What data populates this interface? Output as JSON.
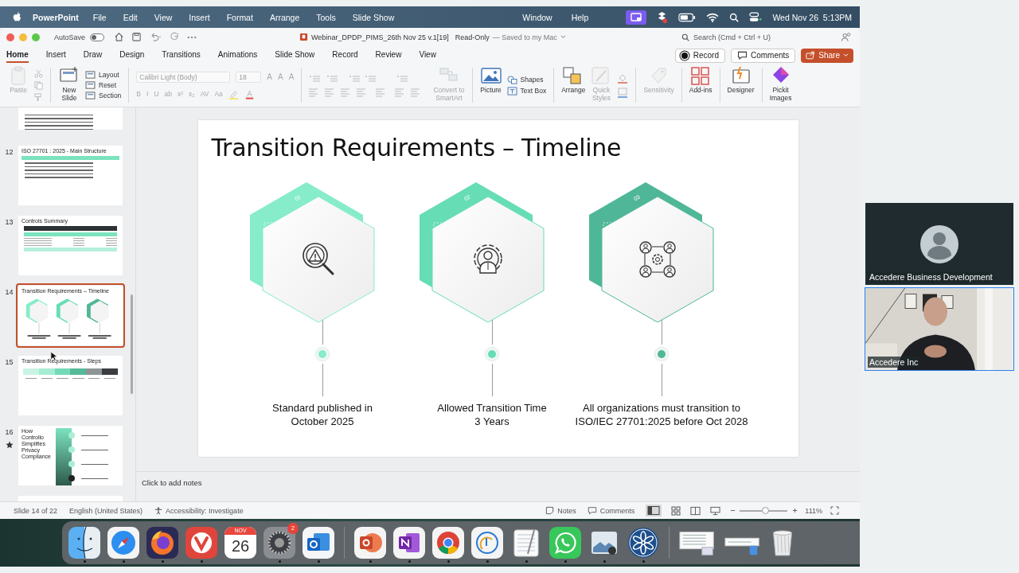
{
  "menu_bar": {
    "app": "PowerPoint",
    "items": [
      "File",
      "Edit",
      "View",
      "Insert",
      "Format",
      "Arrange",
      "Tools",
      "Slide Show"
    ],
    "extra_items": [
      "Window",
      "Help"
    ],
    "clock": "Wed Nov 26  5:13PM"
  },
  "title_bar": {
    "autosave": "AutoSave",
    "autosave_on": false,
    "file": "Webinar_DPDP_PIMS_26th Nov 25 v.1[19]",
    "mode": "Read-Only",
    "saved": "— Saved to my Mac",
    "search_placeholder": "Search (Cmd + Ctrl + U)"
  },
  "tabs": [
    {
      "label": "Home",
      "selected": true
    },
    {
      "label": "Insert",
      "selected": false
    },
    {
      "label": "Draw",
      "selected": false
    },
    {
      "label": "Design",
      "selected": false
    },
    {
      "label": "Transitions",
      "selected": false
    },
    {
      "label": "Animations",
      "selected": false
    },
    {
      "label": "Slide Show",
      "selected": false
    },
    {
      "label": "Record",
      "selected": false
    },
    {
      "label": "Review",
      "selected": false
    },
    {
      "label": "View",
      "selected": false
    }
  ],
  "tab_actions": {
    "record": "Record",
    "comments": "Comments",
    "share": "Share"
  },
  "ribbon": [
    {
      "kind": "paste",
      "label": "Paste",
      "disabled": true
    },
    {
      "kind": "clipboard"
    },
    {
      "kind": "new-slide",
      "label": "New\nSlide",
      "disabled": false
    },
    {
      "kind": "slide-tools",
      "items": [
        "Layout",
        "Reset",
        "Section"
      ]
    },
    {
      "kind": "font",
      "font": "Calibri Light (Body)",
      "size": "18",
      "letters": [
        "A",
        "A",
        "A"
      ],
      "styles": [
        "B",
        "I",
        "U",
        "ab",
        "x²",
        "x₂",
        "AV",
        "Aa"
      ]
    },
    {
      "kind": "paragraph"
    },
    {
      "kind": "smartart",
      "label": "Convert to\nSmartArt",
      "disabled": true
    },
    {
      "kind": "picture",
      "label": "Picture",
      "disabled": false
    },
    {
      "kind": "insert-tools",
      "items": [
        "Shapes",
        "Text Box"
      ]
    },
    {
      "kind": "arrange",
      "label": "Arrange",
      "disabled": false
    },
    {
      "kind": "quick-styles",
      "label": "Quick\nStyles",
      "disabled": true
    },
    {
      "kind": "fill-tools"
    },
    {
      "kind": "sensitivity",
      "label": "Sensitivity",
      "disabled": true
    },
    {
      "kind": "add-ins",
      "label": "Add-ins",
      "disabled": false
    },
    {
      "kind": "designer",
      "label": "Designer",
      "disabled": false
    },
    {
      "kind": "pickit",
      "label": "Pickit\nImages",
      "disabled": false
    }
  ],
  "thumbnails": [
    {
      "kind": "list",
      "selected": false,
      "animated": false
    },
    {
      "number": "12",
      "title": "ISO 27701 : 2025 - Main Structure",
      "kind": "list",
      "selected": false,
      "animated": false
    },
    {
      "number": "13",
      "title": "Controls Summary",
      "kind": "table",
      "selected": false,
      "animated": false
    },
    {
      "number": "14",
      "title": "Transition Requirements – Timeline",
      "kind": "timeline",
      "selected": true,
      "animated": false
    },
    {
      "number": "15",
      "title": "Transition Requirements - Steps",
      "kind": "steps",
      "selected": false,
      "animated": false
    },
    {
      "number": "16",
      "title": "How\nControllo\nSimplifies\nPrivacy\nCompliance",
      "kind": "process",
      "selected": false,
      "animated": true
    }
  ],
  "slide": {
    "title": "Transition Requirements – Timeline",
    "columns": [
      {
        "step": "01",
        "color": "#86ecc9",
        "caption": "Standard published in\nOctober 2025"
      },
      {
        "step": "02",
        "color": "#66ddb4",
        "caption": "Allowed Transition Time\n3 Years"
      },
      {
        "step": "03",
        "color": "#4fb797",
        "caption": "All organizations must transition to\nISO/IEC 27701:2025 before Oct 2028"
      }
    ]
  },
  "notes_placeholder": "Click to add notes",
  "status_bar": {
    "slide": "Slide 14 of 22",
    "language": "English (United States)",
    "accessibility": "Accessibility: Investigate",
    "notes": "Notes",
    "comments": "Comments",
    "zoom_slider": {
      "level": 0.53
    },
    "zoom": "111%"
  },
  "dock": {
    "calendar_month": "NOV",
    "calendar_day": "26",
    "badge": "2",
    "apps": [
      {
        "kind": "finder",
        "running": true
      },
      {
        "kind": "safari",
        "running": true
      },
      {
        "kind": "firefox",
        "running": true
      },
      {
        "kind": "vivaldi",
        "running": true
      },
      {
        "kind": "calendar",
        "running": false
      },
      {
        "kind": "settings",
        "running": true
      },
      {
        "kind": "outlook",
        "running": true
      },
      {
        "kind": "powerpoint",
        "running": true
      },
      {
        "kind": "onenote",
        "running": true
      },
      {
        "kind": "chrome",
        "running": true
      },
      {
        "kind": "scanner",
        "running": true
      },
      {
        "kind": "notepad",
        "running": true
      },
      {
        "kind": "whatsapp",
        "running": true
      },
      {
        "kind": "preview",
        "running": true
      },
      {
        "kind": "teams",
        "running": true
      }
    ]
  },
  "participants": [
    {
      "name": "Accedere Business Development",
      "video": false,
      "speaking": false
    },
    {
      "name": "Accedere Inc",
      "video": true,
      "speaking": true
    }
  ]
}
